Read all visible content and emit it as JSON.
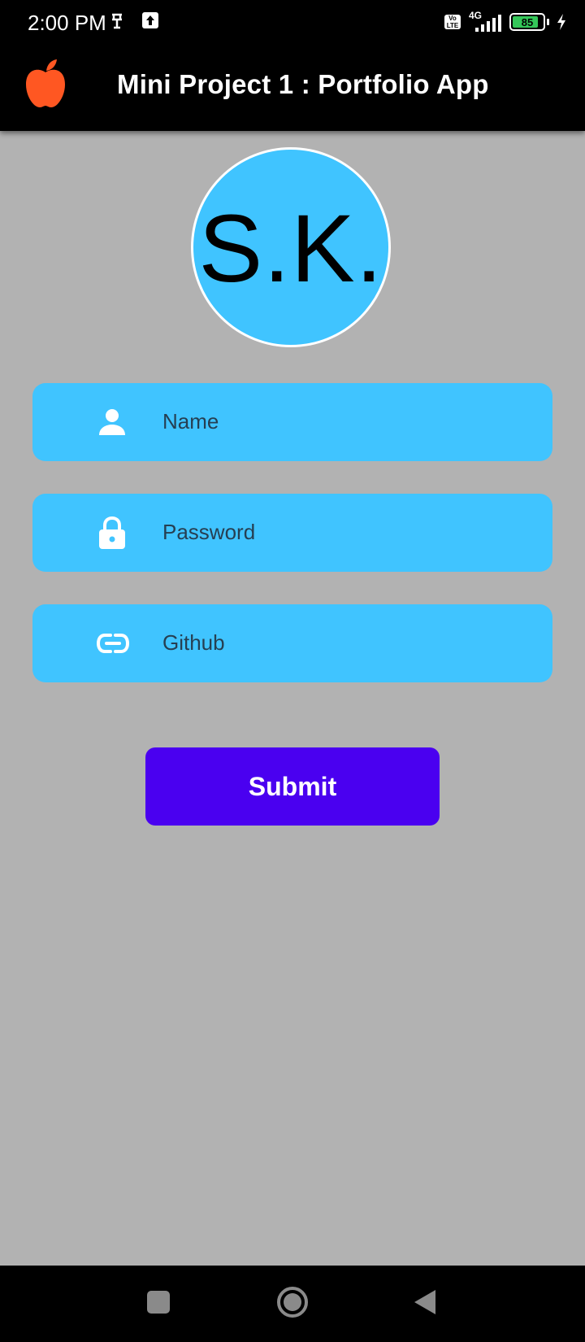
{
  "status_bar": {
    "time": "2:00 PM",
    "network": "4G",
    "volte": "Vo LTE",
    "battery": "85"
  },
  "app_bar": {
    "title": "Mini Project 1 : Portfolio App",
    "logo_icon": "apple-icon",
    "logo_color": "#ff5722"
  },
  "avatar": {
    "initials": "S.K.",
    "color": "#40c4ff"
  },
  "form": {
    "fields": [
      {
        "icon": "person-icon",
        "placeholder": "Name"
      },
      {
        "icon": "lock-icon",
        "placeholder": "Password"
      },
      {
        "icon": "link-icon",
        "placeholder": "Github"
      }
    ],
    "submit_label": "Submit",
    "field_color": "#40c4ff",
    "submit_color": "#4a00f0"
  },
  "nav_bar": {
    "recents_icon": "square-icon",
    "home_icon": "circle-home-icon",
    "back_icon": "triangle-back-icon"
  },
  "colors": {
    "background": "#b2b2b2",
    "app_bar": "#000000"
  }
}
